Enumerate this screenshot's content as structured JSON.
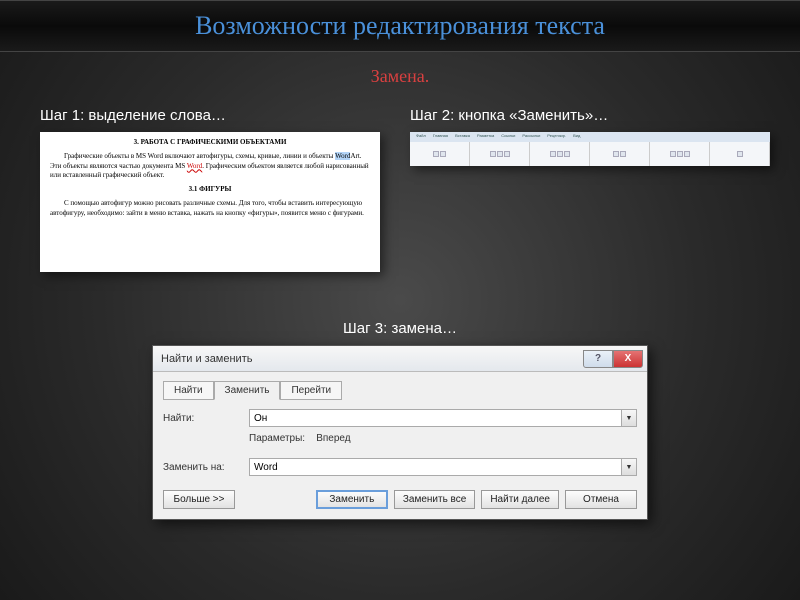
{
  "title": "Возможности редактирования текста",
  "subtitle": "Замена.",
  "step1": {
    "label": "Шаг 1: выделение слова…",
    "doc": {
      "heading1": "3. РАБОТА С ГРАФИЧЕСКИМИ ОБЪЕКТАМИ",
      "para1_a": "Графические объекты в MS Word включают автофигуры, схемы, кривые, линии и объекты ",
      "para1_hl": "Word",
      "para1_b": "Art. Эти объекты являются частью документа MS ",
      "para1_link": "Word",
      "para1_c": ". Графическим объектом является любой нарисованный или вставленный графи­ческий объект.",
      "heading2": "3.1 ФИГУРЫ",
      "para2": "С помощью автофигур можно рисовать различные схемы. Для того, чтобы вставить интересующую автофигуру, необходимо: зайти в меню вставка, нажать на кнопку «фигуры», появится меню с фигурами."
    }
  },
  "step2": {
    "label": "Шаг 2: кнопка «Заменить»…",
    "ribbon_tabs": [
      "Файл",
      "Главная",
      "Вставка",
      "Разметка",
      "Ссылки",
      "Рассылки",
      "Рецензир.",
      "Вид"
    ]
  },
  "step3": {
    "label": "Шаг 3: замена…",
    "dialog": {
      "title": "Найти и заменить",
      "tabs": {
        "find": "Найти",
        "replace": "Заменить",
        "goto": "Перейти"
      },
      "find_label": "Найти:",
      "find_value": "Он",
      "params_label": "Параметры:",
      "params_value": "Вперед",
      "replace_label": "Заменить на:",
      "replace_value": "Word",
      "buttons": {
        "more": "Больше >>",
        "replace": "Заменить",
        "replace_all": "Заменить все",
        "find_next": "Найти далее",
        "cancel": "Отмена"
      },
      "help_symbol": "?",
      "close_symbol": "X"
    }
  }
}
